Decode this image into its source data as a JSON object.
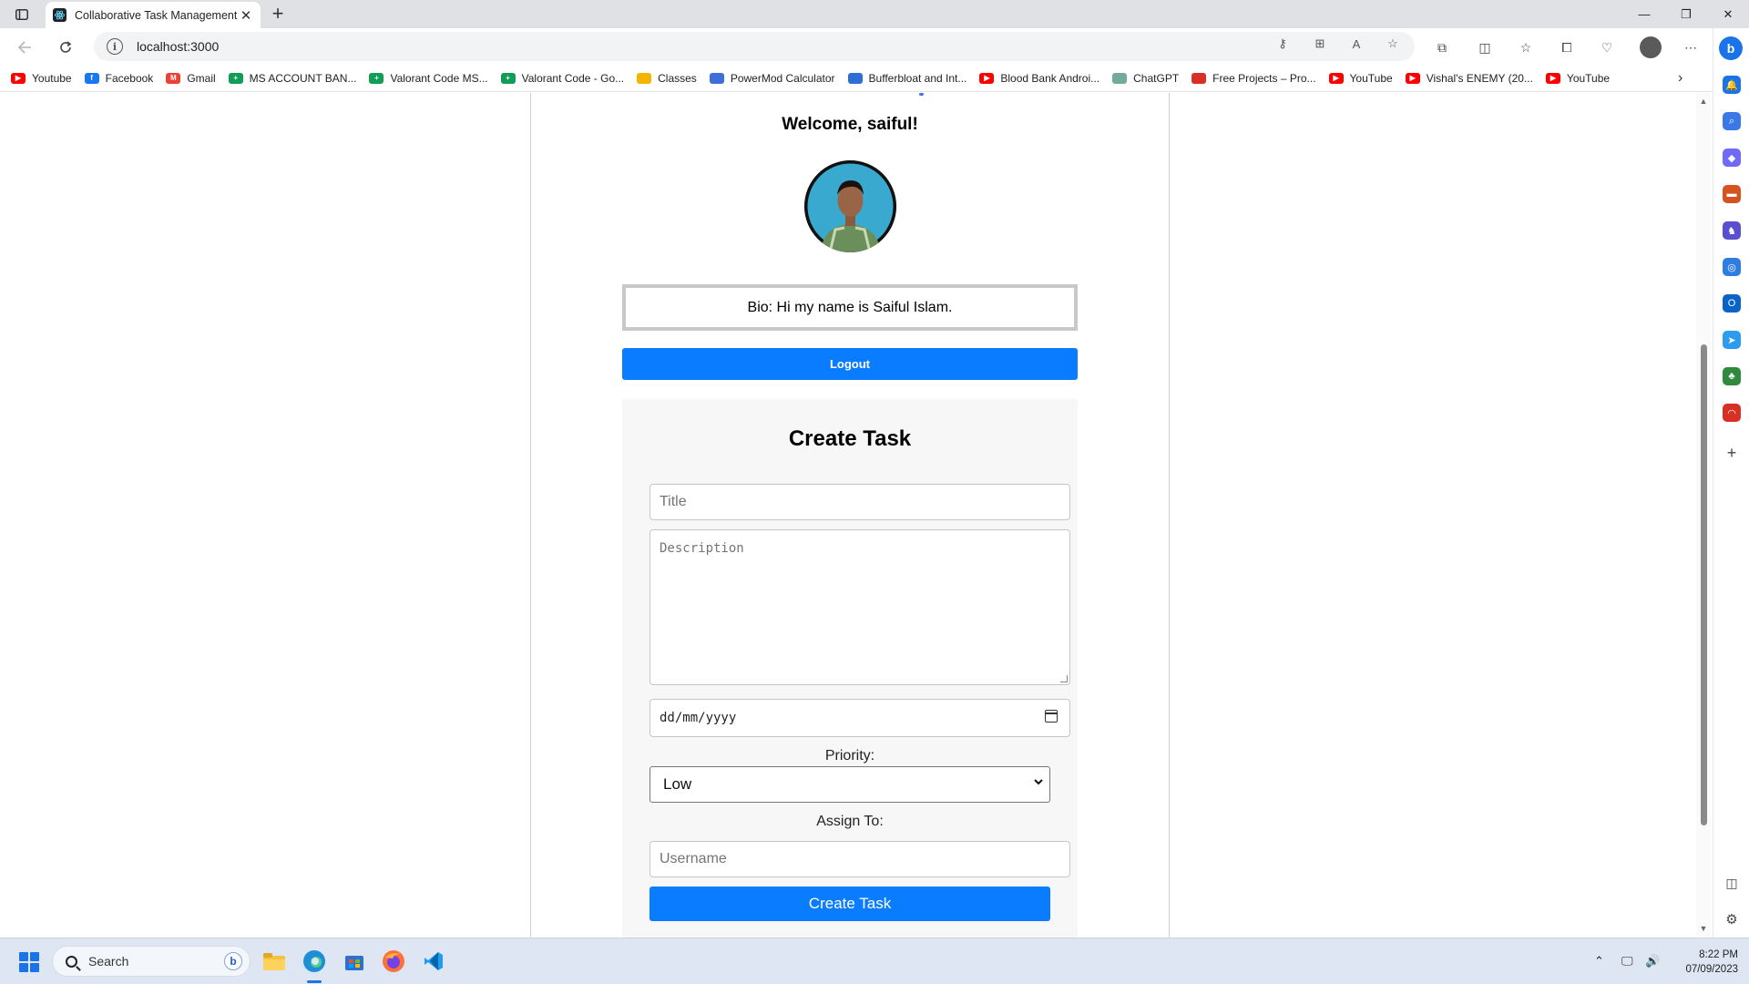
{
  "browser": {
    "tab_title": "Collaborative Task Management",
    "url": "localhost:3000",
    "bookmarks": [
      {
        "label": "Youtube",
        "icon": "youtube-icon",
        "color": "#ff0000"
      },
      {
        "label": "Facebook",
        "icon": "facebook-icon",
        "color": "#1877f2"
      },
      {
        "label": "Gmail",
        "icon": "gmail-icon",
        "color": "#ea4335"
      },
      {
        "label": "MS ACCOUNT BAN...",
        "icon": "sheets-icon",
        "color": "#0f9d58"
      },
      {
        "label": "Valorant Code MS...",
        "icon": "sheets-icon",
        "color": "#0f9d58"
      },
      {
        "label": "Valorant Code - Go...",
        "icon": "sheets-icon",
        "color": "#0f9d58"
      },
      {
        "label": "Classes",
        "icon": "classroom-icon",
        "color": "#f4b400"
      },
      {
        "label": "PowerMod Calculator",
        "icon": "calculator-icon",
        "color": "#3d6fd9"
      },
      {
        "label": "Bufferbloat and Int...",
        "icon": "w-icon",
        "color": "#2d6fd6"
      },
      {
        "label": "Blood Bank Androi...",
        "icon": "youtube-icon",
        "color": "#ff0000"
      },
      {
        "label": "ChatGPT",
        "icon": "chatgpt-icon",
        "color": "#74aa9c"
      },
      {
        "label": "Free Projects – Pro...",
        "icon": "projects-icon",
        "color": "#d93025"
      },
      {
        "label": "YouTube",
        "icon": "youtube-icon",
        "color": "#ff0000"
      },
      {
        "label": "Vishal's ENEMY (20...",
        "icon": "youtube-icon",
        "color": "#ff0000"
      },
      {
        "label": "YouTube",
        "icon": "youtube-icon",
        "color": "#ff0000"
      }
    ]
  },
  "page": {
    "welcome": "Welcome, saiful!",
    "bio": "Bio: Hi my name is Saiful Islam.",
    "logout_label": "Logout",
    "create_task": {
      "heading": "Create Task",
      "title_placeholder": "Title",
      "description_placeholder": "Description",
      "date_placeholder": "dd/mm/yyyy",
      "priority_label": "Priority:",
      "priority_value": "Low",
      "assign_label": "Assign To:",
      "username_placeholder": "Username",
      "submit_label": "Create Task"
    },
    "accent_color": "#0a7cff"
  },
  "taskbar": {
    "search_label": "Search",
    "time": "8:22 PM",
    "date": "07/09/2023"
  }
}
